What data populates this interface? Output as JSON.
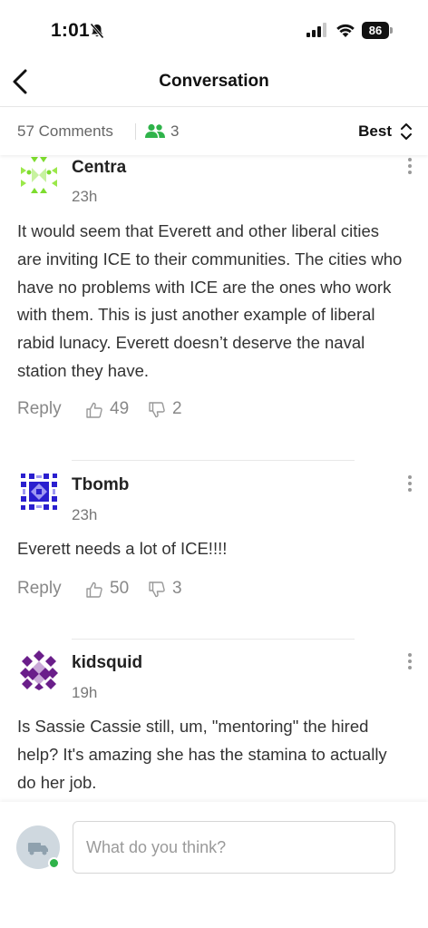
{
  "status_bar": {
    "time": "1:01",
    "battery": "86"
  },
  "header": {
    "title": "Conversation"
  },
  "subheader": {
    "comments_count": "57 Comments",
    "participants_count": "3",
    "sort_label": "Best"
  },
  "comments": [
    {
      "author": "Centra",
      "time": "23h",
      "text": "It would seem that Everett and other liberal cities are inviting ICE to their communities. The cities who have no problems with ICE are the ones who work with them. This is just another example of liberal rabid lunacy. Everett doesn’t deserve the naval station they have.",
      "reply_label": "Reply",
      "likes": "49",
      "dislikes": "2"
    },
    {
      "author": "Tbomb",
      "time": "23h",
      "text": "Everett needs a lot of ICE!!!!",
      "reply_label": "Reply",
      "likes": "50",
      "dislikes": "3"
    },
    {
      "author": "kidsquid",
      "time": "19h",
      "text": "Is Sassie Cassie still, um, \"mentoring\" the hired help? It's amazing she has the stamina to actually do her job."
    }
  ],
  "composer": {
    "placeholder": "What do you think?"
  },
  "colors": {
    "accent_green": "#2fb34a",
    "avatar_centra": "#7ddc2e",
    "avatar_tbomb": "#2a1fcf",
    "avatar_kidsquid": "#6a1e8a"
  }
}
